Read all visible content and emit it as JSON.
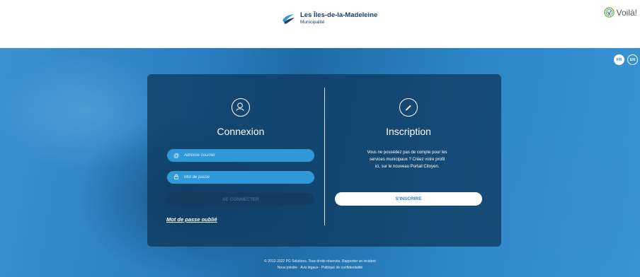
{
  "header": {
    "brand_name": "Les Îles-de-la-Madeleine",
    "brand_sub": "Municipalité",
    "voila": "Voilà!"
  },
  "lang": {
    "fr": "FR",
    "en": "EN"
  },
  "login": {
    "title": "Connexion",
    "email_placeholder": "Adresse courriel",
    "password_placeholder": "Mot de passe",
    "submit_label": "SE CONNECTER",
    "forgot_label": "Mot de passe oublié"
  },
  "signup": {
    "title": "Inscription",
    "text_line1": "Vous ne possédez pas de compte pour les",
    "text_line2": "services municipaux ? Créez votre profil",
    "text_line3": "ici, sur le nouveau Portail Citoyen.",
    "button_label": "S'INSCRIRE"
  },
  "footer": {
    "copyright": "© 2012-2022 PG Solutions. Tous droits réservés.",
    "report_link": "Rapporter un incident",
    "contact_link": "Nous joindre",
    "legal_link": "Avis légaux",
    "privacy_link": "Politique de confidentialité"
  },
  "colors": {
    "accent": "#2f99d8",
    "card": "#0d3458",
    "brand": "#1d3f6e"
  },
  "icons": {
    "user": "user-icon",
    "pencil": "pencil-icon",
    "at": "at-icon",
    "lock": "lock-icon"
  }
}
